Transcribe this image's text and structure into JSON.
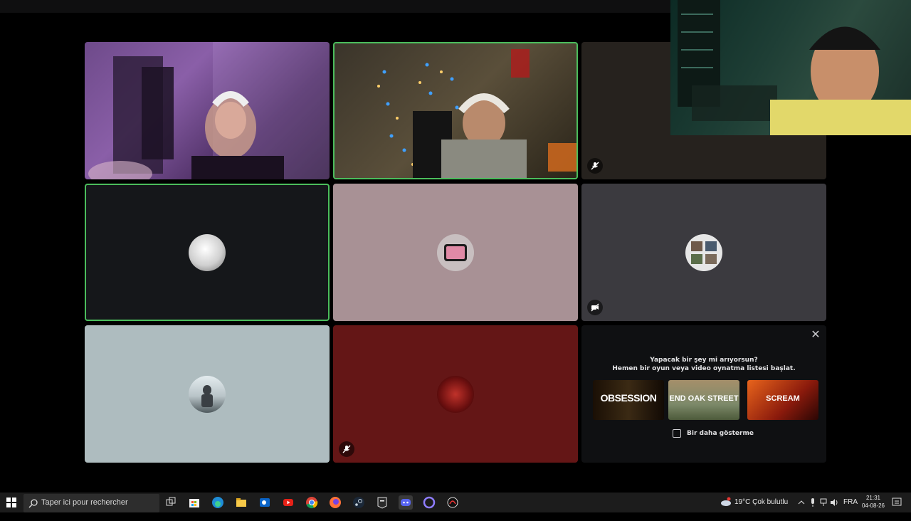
{
  "window": {
    "title": ""
  },
  "promo": {
    "line1": "Yapacak bir şey mi arıyorsun?",
    "line2": "Hemen bir oyun veya video oynatma listesi başlat.",
    "games": [
      {
        "title": "OBSESSION"
      },
      {
        "title": "END OAK STREET"
      },
      {
        "title": "SCREAM"
      }
    ],
    "checkbox_label": "Bir daha gösterme",
    "checked": false
  },
  "participants": [
    {
      "id": "p1",
      "muted": false,
      "speaking": false,
      "camera": true
    },
    {
      "id": "p2",
      "muted": false,
      "speaking": true,
      "camera": true
    },
    {
      "id": "p3",
      "muted": true,
      "speaking": false,
      "camera": false
    },
    {
      "id": "p4",
      "muted": false,
      "speaking": true,
      "camera": false,
      "tile_color": "#15171a"
    },
    {
      "id": "p5",
      "muted": false,
      "speaking": false,
      "camera": false,
      "tile_color": "#a89195"
    },
    {
      "id": "p6",
      "muted": true,
      "speaking": false,
      "camera": false,
      "tile_color": "#3b3a3f"
    },
    {
      "id": "p7",
      "muted": false,
      "speaking": false,
      "camera": false,
      "tile_color": "#aebcbf"
    },
    {
      "id": "p8",
      "muted": true,
      "speaking": false,
      "camera": false,
      "tile_color": "#641616"
    }
  ],
  "taskbar": {
    "search_placeholder": "Taper ici pour rechercher",
    "weather": "19°C  Çok bulutlu",
    "language": "FRA",
    "time": "21:31",
    "date": "04-08-26",
    "apps": [
      "task-view",
      "store",
      "edge",
      "file-explorer",
      "outlook",
      "youtube",
      "chrome",
      "firefox",
      "steam",
      "epic",
      "discord",
      "app-circle",
      "app-spiral"
    ]
  },
  "colors": {
    "speaking_border": "#4bbd5c",
    "background": "#000000"
  }
}
